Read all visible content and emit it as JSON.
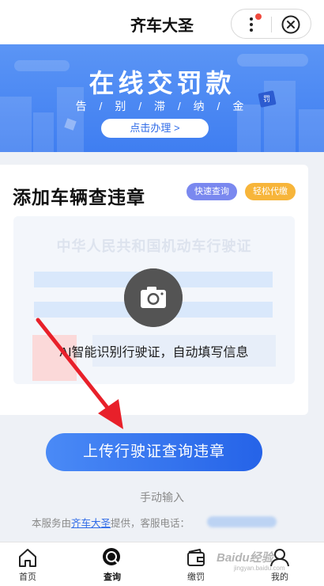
{
  "header": {
    "title": "齐车大圣",
    "more_icon": "more-dots-icon",
    "close_icon": "close-circle-icon",
    "colors": {
      "notification_dot": "#f04a3e"
    }
  },
  "banner": {
    "title": "在线交罚款",
    "subtitle": "告 / 别 / 滞 / 纳 / 金",
    "button_label": "点击办理 >",
    "deco_badge": "罚",
    "colors": {
      "background": "#4a86f3"
    }
  },
  "vehicle_card": {
    "title": "添加车辆查违章",
    "tags": [
      {
        "label": "快速查询",
        "color": "#7a88ef"
      },
      {
        "label": "轻松代缴",
        "color": "#f7b53a"
      }
    ],
    "license": {
      "heading": "中华人民共和国机动车行驶证",
      "camera_icon": "camera-icon",
      "hint": "AI智能识别行驶证，自动填写信息"
    }
  },
  "actions": {
    "upload_label": "上传行驶证查询违章",
    "manual_label": "手动输入",
    "service_prefix": "本服务由",
    "service_brand": "齐车大圣",
    "service_suffix": "提供，客服电话："
  },
  "tabbar": {
    "items": [
      {
        "label": "首页",
        "icon": "home-icon",
        "active": false
      },
      {
        "label": "查询",
        "icon": "search-icon",
        "active": true
      },
      {
        "label": "缴罚",
        "icon": "wallet-icon",
        "active": false
      },
      {
        "label": "我的",
        "icon": "user-icon",
        "active": false
      }
    ]
  },
  "watermark": {
    "text": "Baidu经验",
    "subtext": "jingyan.baidu.com"
  },
  "colors": {
    "primary": "#2f6be7",
    "annotation_arrow": "#e8202a"
  }
}
